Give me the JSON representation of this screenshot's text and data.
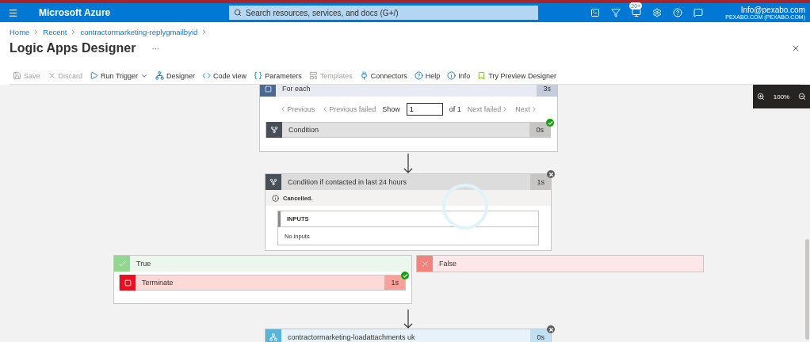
{
  "header": {
    "brand": "Microsoft Azure",
    "search_placeholder": "Search resources, services, and docs (G+/)",
    "notification_count": "20+",
    "account_email": "Info@pexabo.com",
    "account_tenant": "PEXABO.COM (PEXABO.COM)"
  },
  "breadcrumb": [
    "Home",
    "Recent",
    "contractormarketing-replygmailbyid"
  ],
  "title": "Logic Apps Designer",
  "more": "···",
  "toolbar": [
    {
      "kind": "save",
      "label": "Save",
      "disabled": true
    },
    {
      "kind": "discard",
      "label": "Discard",
      "disabled": true
    },
    {
      "kind": "run",
      "label": "Run Trigger",
      "disabled": false
    },
    {
      "kind": "designer",
      "label": "Designer",
      "disabled": false
    },
    {
      "kind": "code",
      "label": "Code view",
      "disabled": false
    },
    {
      "kind": "parameters",
      "label": "Parameters",
      "disabled": false
    },
    {
      "kind": "templates",
      "label": "Templates",
      "disabled": true
    },
    {
      "kind": "connectors",
      "label": "Connectors",
      "disabled": false
    },
    {
      "kind": "help",
      "label": "Help",
      "disabled": false
    },
    {
      "kind": "info",
      "label": "Info",
      "disabled": false
    },
    {
      "kind": "preview",
      "label": "Try Preview Designer",
      "disabled": false
    }
  ],
  "canvas": {
    "for_each": {
      "title": "For each",
      "duration": "3s",
      "pager": {
        "previous": "Previous",
        "previous_failed": "Previous failed",
        "show": "Show",
        "value": "1",
        "of": "of 1",
        "next_failed": "Next failed",
        "next": "Next"
      },
      "children": [
        {
          "title": "Condition",
          "duration": "0s",
          "succeeded": true
        }
      ]
    },
    "condition": {
      "title": "Condition if contacted in last 24 hours",
      "duration": "1s",
      "succeeded": false,
      "message": "Cancelled.",
      "inputs_title": "INPUTS",
      "inputs_text": "No inputs"
    },
    "branches": [
      {
        "kind": "true",
        "label": "True",
        "actions": [
          {
            "title": "Terminate",
            "duration": "1s",
            "succeeded": true
          }
        ]
      },
      {
        "kind": "false",
        "label": "False"
      }
    ],
    "next_action": {
      "title": "contractormarketing-loadattachments uk",
      "duration": "0s",
      "succeeded": false
    },
    "zoom": "100%"
  }
}
